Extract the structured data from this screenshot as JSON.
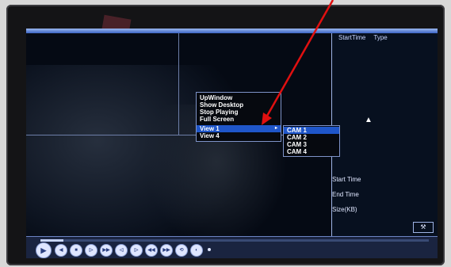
{
  "right_panel": {
    "header_start_time": "StartTime",
    "header_type": "Type",
    "start_time_label": "Start Time",
    "end_time_label": "End Time",
    "size_label": "Size(KB)",
    "up_button_icon": "wrench-icon"
  },
  "context_menu": {
    "items": [
      "UpWindow",
      "Show Desktop",
      "Stop Playing",
      "Full Screen"
    ],
    "view_items": [
      "View 1",
      "View 4"
    ],
    "submenu_arrow": "▸"
  },
  "submenu": {
    "items": [
      "CAM 1",
      "CAM 2",
      "CAM 3",
      "CAM 4"
    ]
  },
  "playback": {
    "progress": 0.06,
    "buttons": [
      "play",
      "rewind",
      "stop",
      "slow",
      "fast",
      "prev-frame",
      "next-frame",
      "prev-file",
      "next-file",
      "repeat",
      "sound"
    ]
  },
  "annotation": {
    "arrow_color": "#e01010"
  },
  "colors": {
    "menu_highlight": "#1f56c9",
    "title_bar": "#3b64c4"
  }
}
